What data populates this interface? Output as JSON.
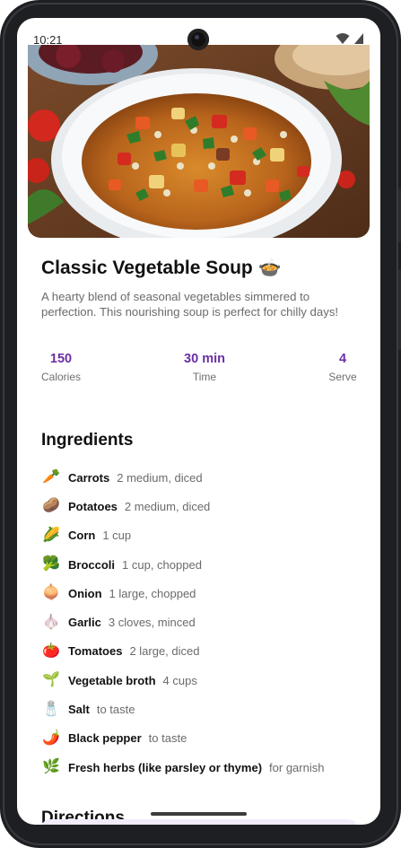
{
  "status_bar": {
    "time": "10:21",
    "icons": [
      "wifi-icon",
      "signal-icon"
    ]
  },
  "recipe": {
    "image": "vegetable-soup-photo",
    "title": "Classic Vegetable Soup 🍲",
    "description": "A hearty blend of seasonal vegetables simmered to perfection. This nourishing soup is perfect for chilly days!",
    "stats": [
      {
        "value": "150",
        "label": "Calories"
      },
      {
        "value": "30 min",
        "label": "Time"
      },
      {
        "value": "4",
        "label": "Serve"
      }
    ]
  },
  "ingredients": {
    "title": "Ingredients",
    "items": [
      {
        "emoji": "🥕",
        "name": "Carrots",
        "qty": "2 medium, diced"
      },
      {
        "emoji": "🥔",
        "name": "Potatoes",
        "qty": "2 medium, diced"
      },
      {
        "emoji": "🌽",
        "name": "Corn",
        "qty": "1 cup"
      },
      {
        "emoji": "🥦",
        "name": "Broccoli",
        "qty": "1 cup, chopped"
      },
      {
        "emoji": "🧅",
        "name": "Onion",
        "qty": "1 large, chopped"
      },
      {
        "emoji": "🧄",
        "name": "Garlic",
        "qty": "3 cloves, minced"
      },
      {
        "emoji": "🍅",
        "name": "Tomatoes",
        "qty": "2 large, diced"
      },
      {
        "emoji": "🌱",
        "name": "Vegetable broth",
        "qty": "4 cups"
      },
      {
        "emoji": "🧂",
        "name": "Salt",
        "qty": "to taste"
      },
      {
        "emoji": "🌶️",
        "name": "Black pepper",
        "qty": "to taste"
      },
      {
        "emoji": "🌿",
        "name": "Fresh herbs (like parsley or thyme)",
        "qty": "for garnish"
      }
    ]
  },
  "directions": {
    "title": "Directions"
  },
  "colors": {
    "accent": "#6a2ea3",
    "directions_card": "#f1ebfb"
  }
}
